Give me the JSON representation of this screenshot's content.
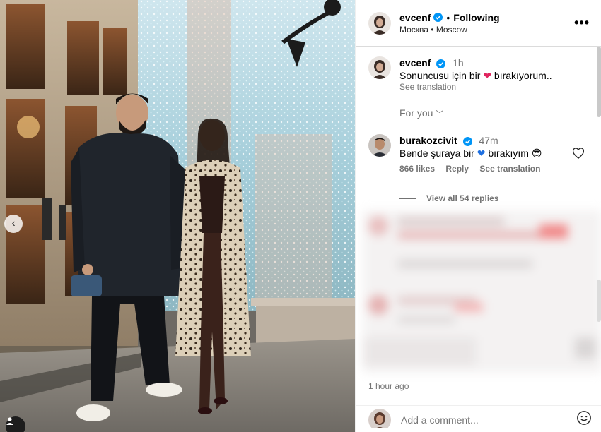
{
  "header": {
    "username": "evcenf",
    "separator": "•",
    "follow_status": "Following",
    "location": "Москва • Moscow"
  },
  "caption_comment": {
    "username": "evcenf",
    "time": "1h",
    "text_before": "Sonuncusu için bir",
    "text_after": "bırakıyorum..",
    "see_translation": "See translation"
  },
  "for_you": "For you",
  "reply_comment": {
    "username": "burakozcivit",
    "time": "47m",
    "text_before": "Bende şuraya bir",
    "text_after": "bırakıyım",
    "likes": "866 likes",
    "reply": "Reply",
    "see_translation": "See translation",
    "view_replies": "View all 54 replies"
  },
  "post_time": "1 hour ago",
  "add_comment": {
    "placeholder": "Add a comment..."
  },
  "icons": {
    "verified": "verified-badge-icon",
    "more": "more-options-icon",
    "heart": "heart-icon",
    "emoji": "emoji-icon",
    "prev": "chevron-left-icon",
    "user": "user-tag-icon"
  },
  "colors": {
    "verified": "#0095f6",
    "red_heart": "#e0245e",
    "blue_heart": "#1d6fe0"
  }
}
